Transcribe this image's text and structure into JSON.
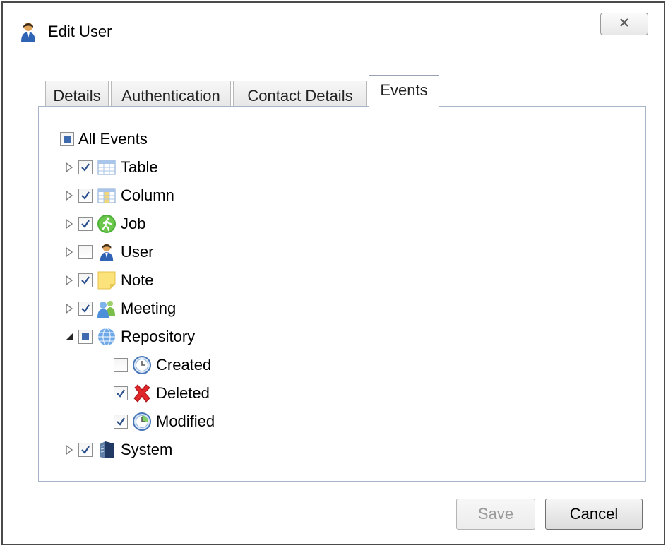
{
  "window": {
    "title": "Edit User",
    "title_icon": "user-icon",
    "close_icon": "close-icon"
  },
  "tabs": [
    {
      "label": "Details",
      "active": false
    },
    {
      "label": "Authentication",
      "active": false
    },
    {
      "label": "Contact Details",
      "active": false
    },
    {
      "label": "Events",
      "active": true
    }
  ],
  "tree": {
    "all_events": {
      "label": "All Events",
      "state": "partial"
    },
    "items": [
      {
        "label": "Table",
        "checked": "checked",
        "expanded": false,
        "icon": "table-icon"
      },
      {
        "label": "Column",
        "checked": "checked",
        "expanded": false,
        "icon": "column-icon"
      },
      {
        "label": "Job",
        "checked": "checked",
        "expanded": false,
        "icon": "job-icon"
      },
      {
        "label": "User",
        "checked": "unchecked",
        "expanded": false,
        "icon": "user-icon"
      },
      {
        "label": "Note",
        "checked": "checked",
        "expanded": false,
        "icon": "note-icon"
      },
      {
        "label": "Meeting",
        "checked": "checked",
        "expanded": false,
        "icon": "meeting-icon"
      },
      {
        "label": "Repository",
        "checked": "partial",
        "expanded": true,
        "icon": "repository-icon",
        "children": [
          {
            "label": "Created",
            "checked": "unchecked",
            "icon": "clock-icon"
          },
          {
            "label": "Deleted",
            "checked": "checked",
            "icon": "delete-icon"
          },
          {
            "label": "Modified",
            "checked": "checked",
            "icon": "modified-icon"
          }
        ]
      },
      {
        "label": "System",
        "checked": "checked",
        "expanded": false,
        "icon": "system-icon"
      }
    ]
  },
  "buttons": {
    "save_label": "Save",
    "save_enabled": false,
    "cancel_label": "Cancel"
  },
  "colors": {
    "checkbox_partial": "#3e6bb0",
    "tab_panel_border": "#a7b4c9"
  }
}
